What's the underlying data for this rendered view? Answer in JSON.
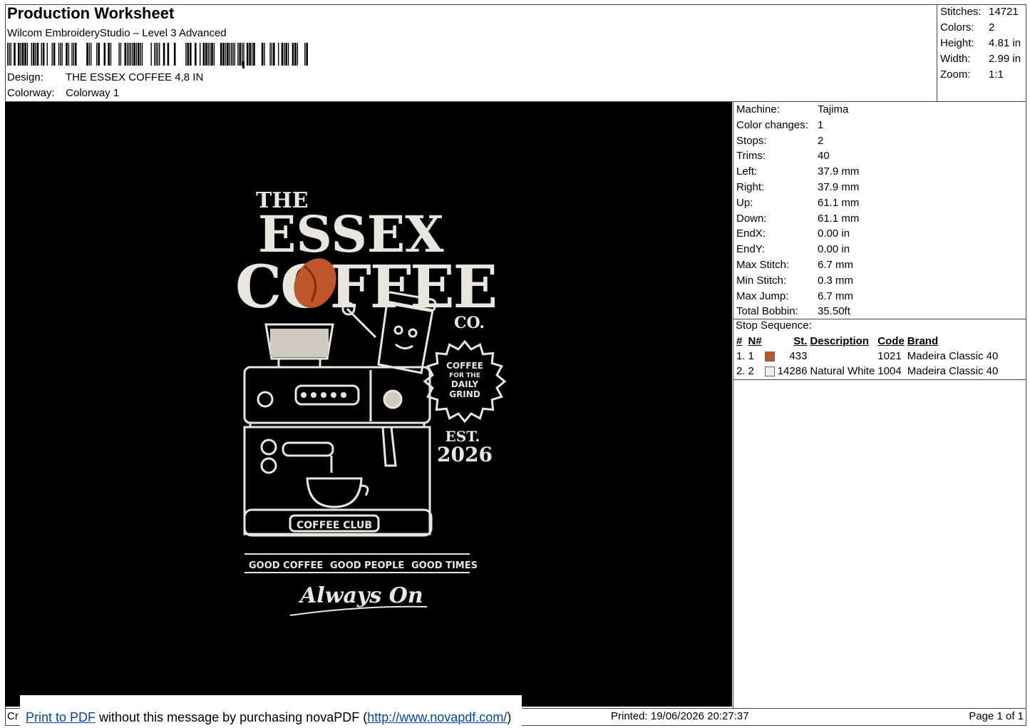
{
  "header": {
    "title": "Production Worksheet",
    "software": "Wilcom EmbroideryStudio – Level 3 Advanced",
    "design_label": "Design:",
    "design_value": "THE ESSEX COFFEE 4,8 IN",
    "colorway_label": "Colorway:",
    "colorway_value": "Colorway 1"
  },
  "stats": [
    {
      "label": "Stitches:",
      "value": "14721"
    },
    {
      "label": "Colors:",
      "value": "2"
    },
    {
      "label": "Height:",
      "value": "4.81 in"
    },
    {
      "label": "Width:",
      "value": "2.99 in"
    },
    {
      "label": "Zoom:",
      "value": "1:1"
    }
  ],
  "machine": [
    {
      "label": "Machine:",
      "value": "Tajima"
    },
    {
      "label": "Color changes:",
      "value": "1"
    },
    {
      "label": "Stops:",
      "value": "2"
    },
    {
      "label": "Trims:",
      "value": "40"
    },
    {
      "label": "Left:",
      "value": "37.9 mm"
    },
    {
      "label": "Right:",
      "value": "37.9 mm"
    },
    {
      "label": "Up:",
      "value": "61.1 mm"
    },
    {
      "label": "Down:",
      "value": "61.1 mm"
    },
    {
      "label": "EndX:",
      "value": "0.00 in"
    },
    {
      "label": "EndY:",
      "value": "0.00 in"
    },
    {
      "label": "Max Stitch:",
      "value": "6.7 mm"
    },
    {
      "label": "Min Stitch:",
      "value": "0.3 mm"
    },
    {
      "label": "Max Jump:",
      "value": "6.7 mm"
    },
    {
      "label": "Total Bobbin:",
      "value": "35.50ft"
    }
  ],
  "stop_sequence": {
    "title": "Stop Sequence:",
    "columns": [
      "#",
      "N#",
      "St.",
      "Description",
      "Code",
      "Brand"
    ],
    "rows": [
      {
        "idx": "1.",
        "n": "1",
        "color": "#c0552a",
        "st": "433",
        "desc": "",
        "code": "1021",
        "brand": "Madeira Classic 40"
      },
      {
        "idx": "2.",
        "n": "2",
        "color": "#f0f0f0",
        "st": "14286",
        "desc": "Natural White",
        "code": "1004",
        "brand": "Madeira Classic 40"
      }
    ]
  },
  "design_text": {
    "the": "THE",
    "essex": "ESSEX",
    "coffee": "COFFEE",
    "co": "CO.",
    "badge1": "COFFEE",
    "badge2": "FOR THE",
    "badge3": "DAILY",
    "badge4": "GRIND",
    "est": "EST.",
    "year": "2026",
    "club": "COFFEE CLUB",
    "tag1": "GOOD COFFEE",
    "tag2": "GOOD PEOPLE",
    "tag3": "GOOD TIMES",
    "script": "Always On"
  },
  "footer": {
    "left_fragment": "Cr",
    "printed": "Printed: 19/06/2026 20:27:37",
    "page": "Page 1 of 1",
    "nova_link": "Print to PDF",
    "nova_mid": " without this message by purchasing novaPDF (",
    "nova_url": "http://www.novapdf.com/",
    "nova_end": ")"
  },
  "colors": {
    "thread_orange": "#c0552a",
    "thread_white": "#e8e6df",
    "background": "#000000"
  }
}
